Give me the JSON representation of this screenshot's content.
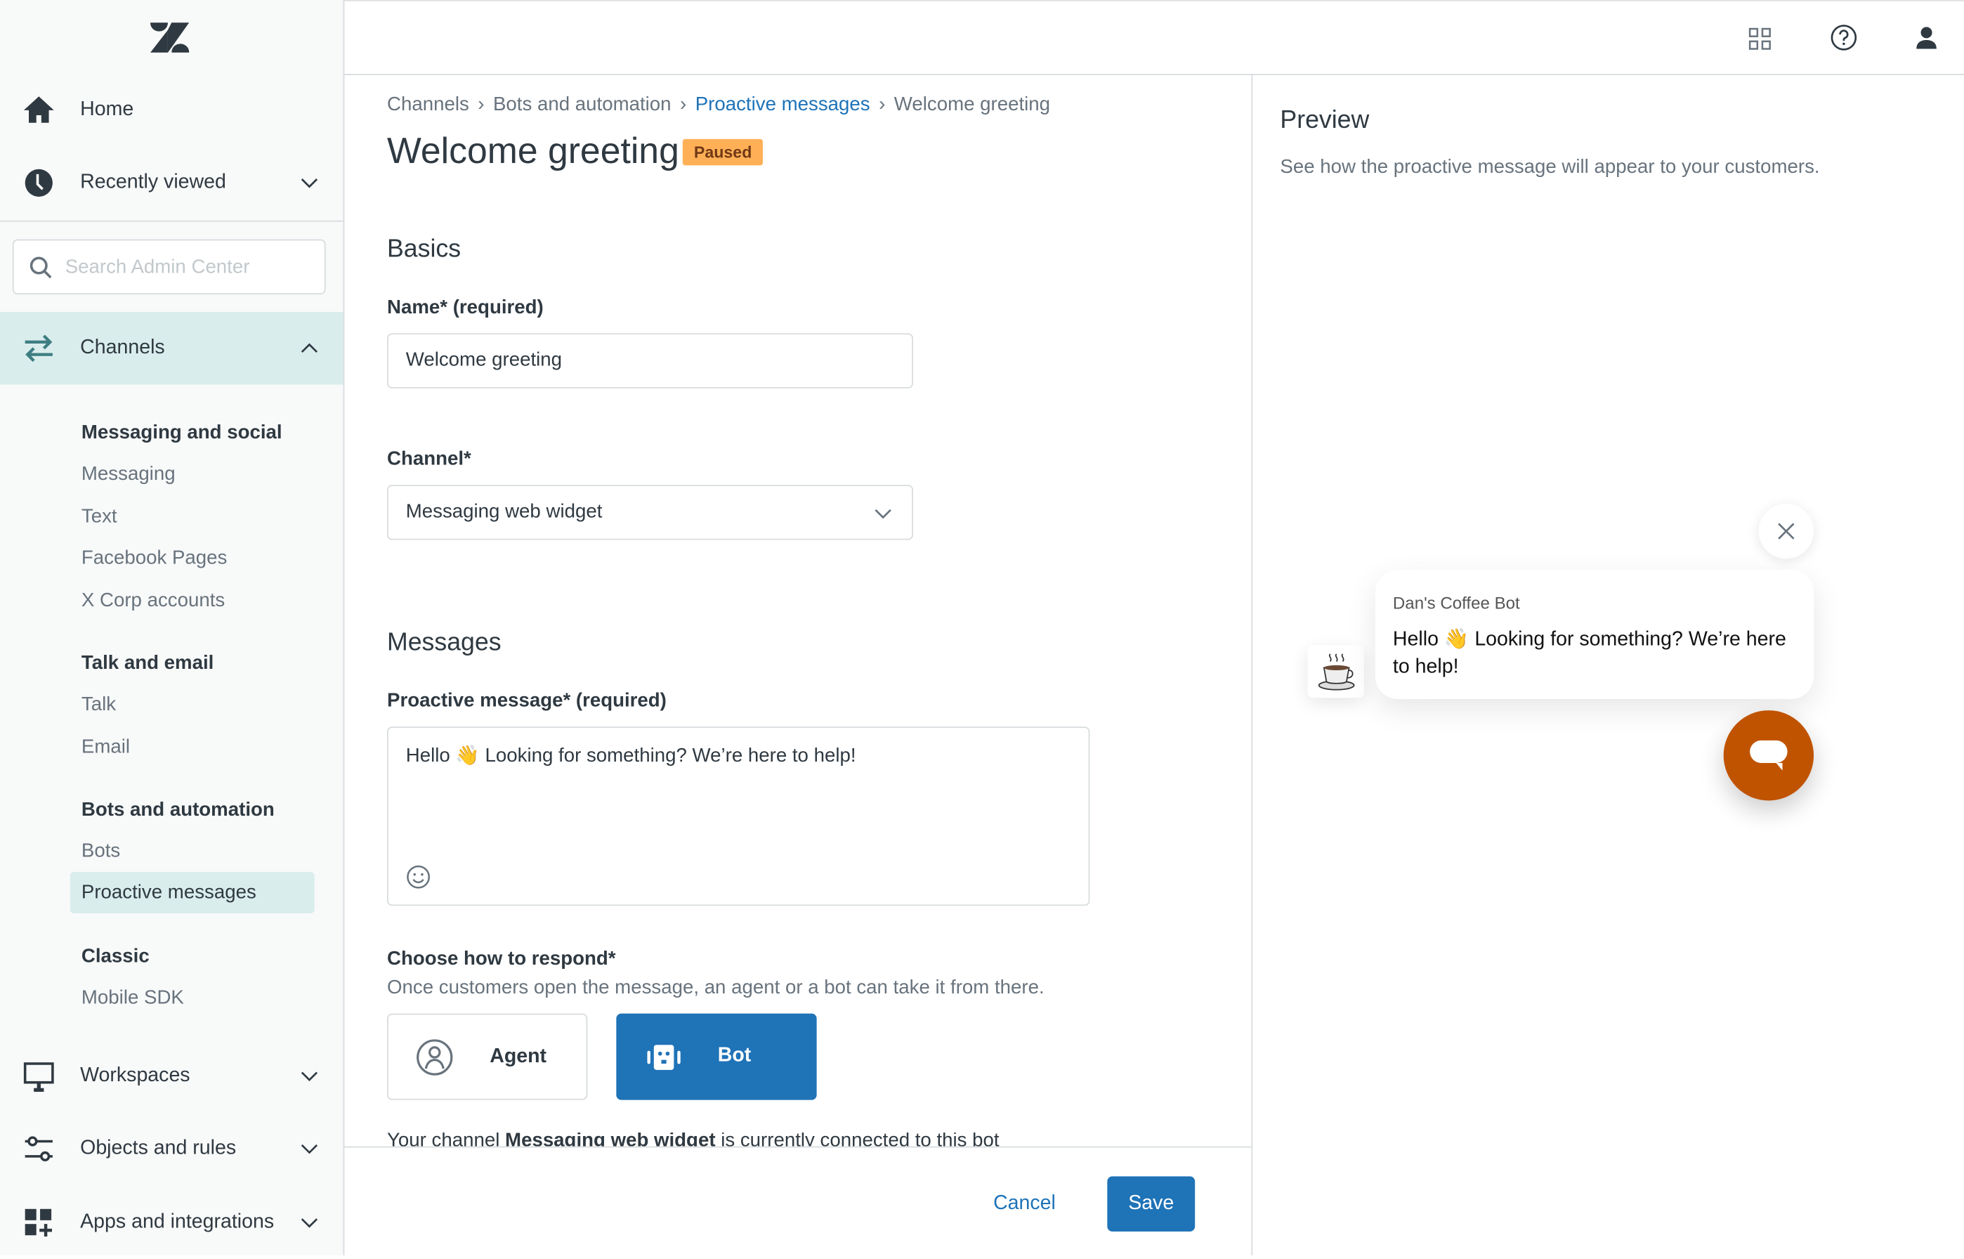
{
  "sidebar": {
    "nav": [
      {
        "label": "Home",
        "icon": "home-icon"
      },
      {
        "label": "Recently viewed",
        "icon": "clock-icon"
      },
      {
        "label": "Channels",
        "icon": "arrows-icon"
      },
      {
        "label": "Workspaces",
        "icon": "monitor-icon"
      },
      {
        "label": "Objects and rules",
        "icon": "objects-icon"
      },
      {
        "label": "Apps and integrations",
        "icon": "apps-icon"
      }
    ],
    "search_placeholder": "Search Admin Center",
    "groups": [
      {
        "title": "Messaging and social",
        "items": [
          "Messaging",
          "Text",
          "Facebook Pages",
          "X Corp accounts"
        ]
      },
      {
        "title": "Talk and email",
        "items": [
          "Talk",
          "Email"
        ]
      },
      {
        "title": "Bots and automation",
        "items": [
          "Bots",
          "Proactive messages"
        ]
      },
      {
        "title": "Classic",
        "items": [
          "Mobile SDK"
        ]
      }
    ],
    "active_item": "Proactive messages"
  },
  "breadcrumb": [
    "Channels",
    "Bots and automation",
    "Proactive messages",
    "Welcome greeting"
  ],
  "page": {
    "title": "Welcome greeting",
    "status": "Paused",
    "status_color": "#ffb057",
    "basics_heading": "Basics",
    "name_label": "Name* (required)",
    "name_value": "Welcome greeting",
    "channel_label": "Channel*",
    "channel_value": "Messaging web widget",
    "messages_heading": "Messages",
    "message_label": "Proactive message* (required)",
    "message_value": "Hello 👋 Looking for something? We’re here to help!",
    "respond_label": "Choose how to respond*",
    "respond_hint": "Once customers open the message, an agent or a bot can take it from there.",
    "respond_options": [
      "Agent",
      "Bot"
    ],
    "respond_selected": "Bot",
    "connected_pre": "Your channel ",
    "connected_bold": "Messaging web widget",
    "connected_post": " is currently connected to this bot",
    "cancel": "Cancel",
    "save": "Save",
    "accent": "#1f73b7"
  },
  "preview": {
    "title": "Preview",
    "subtitle": "See how the proactive message will appear to your customers.",
    "bot_name": "Dan's Coffee Bot",
    "message": "Hello 👋 Looking for something? We’re here to help!",
    "launcher_color": "#c05300"
  }
}
